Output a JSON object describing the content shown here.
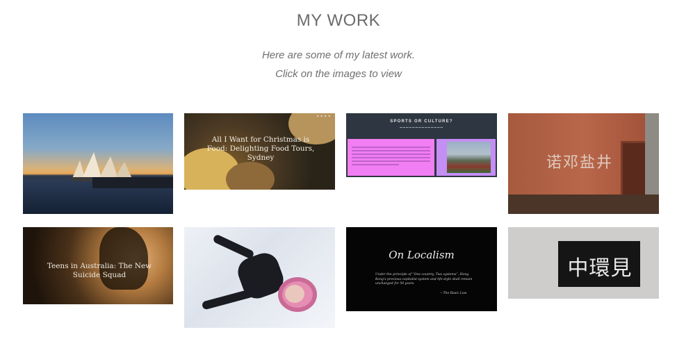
{
  "section": {
    "title": "MY WORK",
    "subtitle_line1": "Here are some of my latest work.",
    "subtitle_line2": "Click on the images to view"
  },
  "gallery": [
    {
      "caption": ""
    },
    {
      "caption": "All I Want for Christmas is Food: Delighting Food Tours, Sydney"
    },
    {
      "heading": "SPORTS OR CULTURE?"
    },
    {
      "caption": ""
    },
    {
      "caption": "Teens in Australia: The New Suicide Squad"
    },
    {
      "caption": ""
    },
    {
      "heading": "On Localism",
      "quote": "Under the principle of “One country, Two systems”, Hong Kong's previous capitalist system and life-style shall remain unchanged for 50 years.",
      "attribution": "—The Basic Law"
    },
    {
      "caption": ""
    }
  ]
}
